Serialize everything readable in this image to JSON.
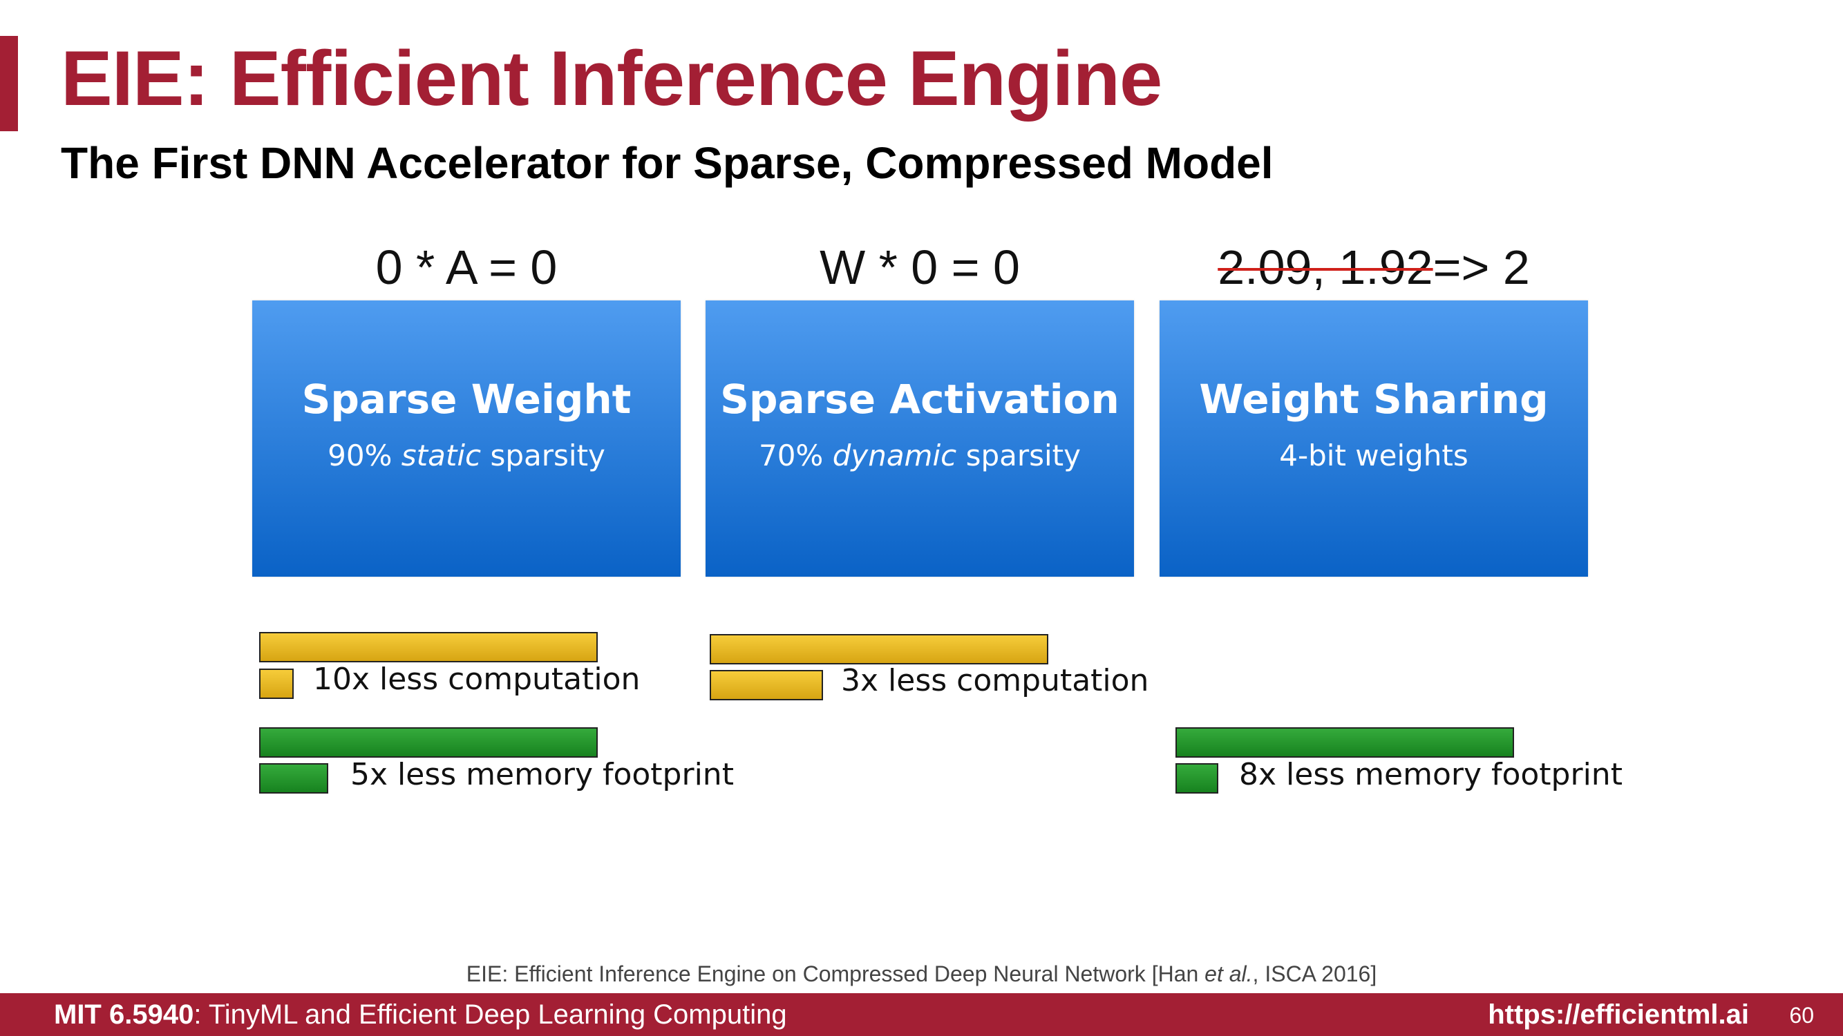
{
  "slide": {
    "title": "EIE: Efficient Inference Engine",
    "subtitle": "The First DNN Accelerator for Sparse, Compressed Model"
  },
  "columns": [
    {
      "equation": "0 * A = 0",
      "box_title": "Sparse Weight",
      "box_sub_pre": "90% ",
      "box_sub_em": "static",
      "box_sub_post": " sparsity"
    },
    {
      "equation": "W * 0 = 0",
      "box_title": "Sparse Activation",
      "box_sub_pre": "70% ",
      "box_sub_em": "dynamic",
      "box_sub_post": " sparsity"
    },
    {
      "equation_struck": "2.09, 1.92",
      "equation_rest": "=> 2",
      "box_title": "Weight Sharing",
      "box_sub": "4-bit weights"
    }
  ],
  "metrics": {
    "computation_weight": "10x less computation",
    "computation_activation": "3x less computation",
    "memory_weight": "5x less memory footprint",
    "memory_sharing": "8x less memory footprint"
  },
  "citation": {
    "pre": "EIE: Efficient Inference Engine on Compressed Deep Neural Network [Han ",
    "em": "et al.",
    "post": ", ISCA 2016]"
  },
  "footer": {
    "course_code": "MIT 6.5940",
    "course_name": ": TinyML and Efficient Deep Learning Computing",
    "url": "https://efficientml.ai",
    "page": "60"
  },
  "colors": {
    "brand": "#a31f34",
    "box_top": "#4f9cf0",
    "box_bottom": "#0a62c6",
    "computation_bar": "#e8b826",
    "memory_bar": "#24952c"
  }
}
